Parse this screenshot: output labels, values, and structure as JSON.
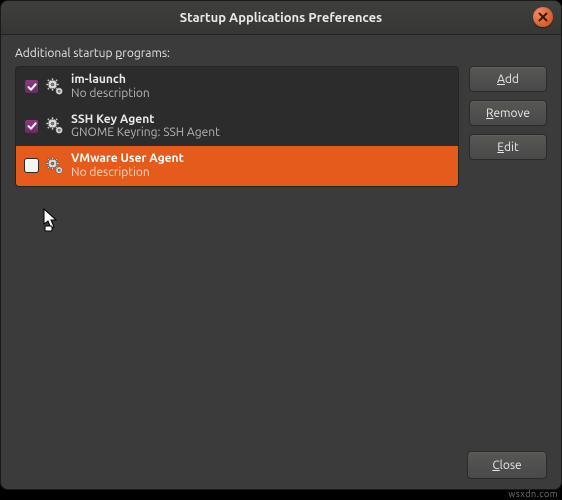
{
  "window": {
    "title": "Startup Applications Preferences"
  },
  "section_label_prefix": "Additional startup ",
  "section_label_underline": "p",
  "section_label_suffix": "rograms:",
  "buttons": {
    "add_pre": "",
    "add_ul": "A",
    "add_post": "dd",
    "remove_pre": "",
    "remove_ul": "R",
    "remove_post": "emove",
    "edit_pre": "",
    "edit_ul": "E",
    "edit_post": "dit",
    "close_pre": "",
    "close_ul": "C",
    "close_post": "lose"
  },
  "items": [
    {
      "name": "im-launch",
      "desc": "No description",
      "checked": true,
      "selected": false
    },
    {
      "name": "SSH Key Agent",
      "desc": "GNOME Keyring: SSH Agent",
      "checked": true,
      "selected": false
    },
    {
      "name": "VMware User Agent",
      "desc": "No description",
      "checked": false,
      "selected": true
    }
  ],
  "watermark": "wsxdn.com"
}
